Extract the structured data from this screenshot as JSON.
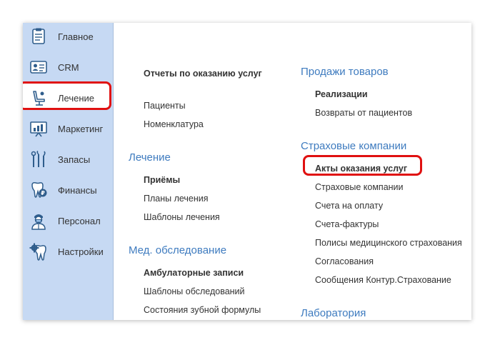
{
  "sidebar": {
    "items": [
      {
        "label": "Главное",
        "icon": "clipboard-icon"
      },
      {
        "label": "CRM",
        "icon": "contact-card-icon"
      },
      {
        "label": "Лечение",
        "icon": "dental-chair-icon"
      },
      {
        "label": "Маркетинг",
        "icon": "presentation-chart-icon"
      },
      {
        "label": "Запасы",
        "icon": "dental-tools-icon"
      },
      {
        "label": "Финансы",
        "icon": "tooth-coin-icon"
      },
      {
        "label": "Персонал",
        "icon": "doctor-icon"
      },
      {
        "label": "Настройки",
        "icon": "tooth-gear-icon"
      }
    ]
  },
  "colors": {
    "sidebar_bg": "#c6d9f3",
    "heading": "#3e7bbf",
    "highlight": "#e01010",
    "icon": "#2f5d8c"
  },
  "left_column": {
    "top_links": [
      {
        "label": "Отчеты по оказанию услуг",
        "bold": true
      },
      {
        "label": "Пациенты",
        "bold": false
      },
      {
        "label": "Номенклатура",
        "bold": false
      }
    ],
    "sections": [
      {
        "heading": "Лечение",
        "links": [
          {
            "label": "Приёмы",
            "bold": true
          },
          {
            "label": "Планы лечения",
            "bold": false
          },
          {
            "label": "Шаблоны лечения",
            "bold": false
          }
        ]
      },
      {
        "heading": "Мед. обследование",
        "links": [
          {
            "label": "Амбулаторные записи",
            "bold": true
          },
          {
            "label": "Шаблоны обследований",
            "bold": false
          },
          {
            "label": "Состояния зубной формулы",
            "bold": false
          }
        ]
      }
    ]
  },
  "right_column": {
    "sections": [
      {
        "heading": "Продажи товаров",
        "links": [
          {
            "label": "Реализации",
            "bold": true
          },
          {
            "label": "Возвраты от пациентов",
            "bold": false
          }
        ]
      },
      {
        "heading": "Страховые компании",
        "links": [
          {
            "label": "Акты оказания услуг",
            "bold": true
          },
          {
            "label": "Страховые компании",
            "bold": false
          },
          {
            "label": "Счета на оплату",
            "bold": false
          },
          {
            "label": "Счета-фактуры",
            "bold": false
          },
          {
            "label": "Полисы медицинского страхования",
            "bold": false
          },
          {
            "label": "Согласования",
            "bold": false
          },
          {
            "label": "Сообщения Контур.Страхование",
            "bold": false
          }
        ]
      },
      {
        "heading": "Лаборатория",
        "links": []
      }
    ]
  }
}
